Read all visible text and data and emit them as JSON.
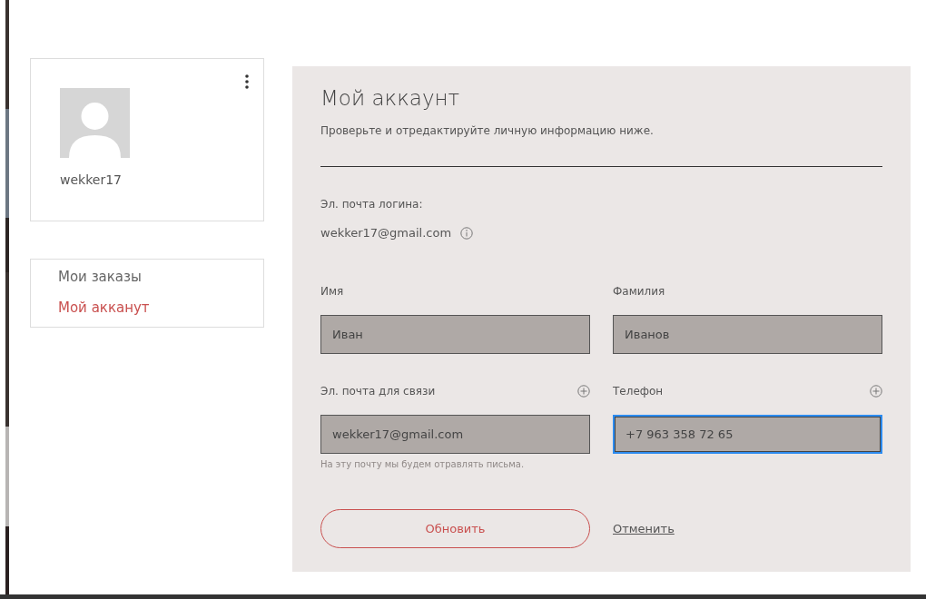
{
  "profile": {
    "username": "wekker17"
  },
  "menu": [
    {
      "label": "Мои заказы",
      "selected": false
    },
    {
      "label": "Мой акканут",
      "selected": true
    }
  ],
  "account": {
    "title": "Мой аккаунт",
    "subtitle": "Проверьте и отредактируйте личную информацию ниже.",
    "login_label": "Эл. почта логина:",
    "login_email": "wekker17@gmail.com",
    "fields": [
      {
        "label": "Имя",
        "value": "Иван",
        "focused": false,
        "addable": false
      },
      {
        "label": "Фамилия",
        "value": "Иванов",
        "focused": false,
        "addable": false
      },
      {
        "label": "Эл. почта для связи",
        "value": "wekker17@gmail.com",
        "focused": false,
        "addable": true,
        "hint": "На эту почту мы будем отравлять письма."
      },
      {
        "label": "Телефон",
        "value": "+7 963 358 72 65",
        "focused": true,
        "addable": true
      }
    ],
    "update_button": "Обновить",
    "cancel_link": "Отменить"
  }
}
